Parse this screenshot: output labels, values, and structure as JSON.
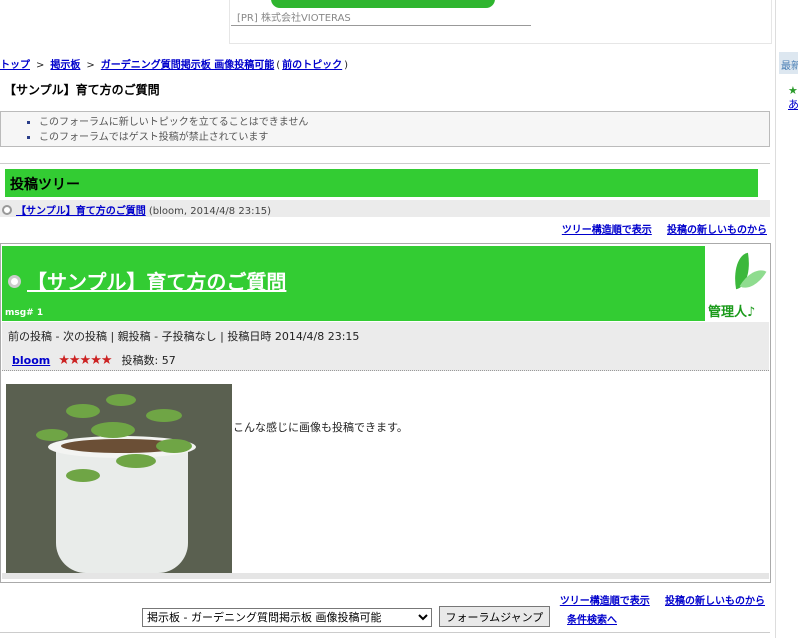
{
  "ad": {
    "text": "[PR] 株式会社VIOTERAS"
  },
  "right_panel": {
    "box_label": "最新",
    "star": "★",
    "link": "あ"
  },
  "breadcrumb": {
    "items": [
      "トップ",
      "掲示板",
      "ガーデニング質問掲示板 画像投稿可能"
    ],
    "separator": ">",
    "prev_topic": "前のトピック",
    "paren_open": "(",
    "paren_close": ")"
  },
  "page": {
    "title": "【サンプル】育て方のご質問"
  },
  "notices": [
    "このフォーラムに新しいトピックを立てることはできません",
    "このフォーラムではゲスト投稿が禁止されています"
  ],
  "tree": {
    "header": "投稿ツリー",
    "row_link": "【サンプル】育て方のご質問",
    "row_meta": "(bloom, 2014/4/8 23:15)",
    "link_tree_order": "ツリー構造順で表示",
    "link_newest": "投稿の新しいものから"
  },
  "post": {
    "title": "【サンプル】育て方のご質問",
    "msg_no": "msg# 1",
    "admin_badge": "管理人♪",
    "nav_line": "前の投稿 - 次の投稿 | 親投稿 - 子投稿なし | 投稿日時 2014/4/8 23:15",
    "author": "bloom",
    "stars": "★★★★★",
    "rating": 5,
    "post_count": "投稿数: 57",
    "body": "こんな感じに画像も投稿できます。"
  },
  "footer": {
    "link_tree_order": "ツリー構造順で表示",
    "link_newest": "投稿の新しいものから",
    "forum_select_value": "掲示板 - ガーデニング質問掲示板 画像投稿可能",
    "jump_button": "フォーラムジャンプ",
    "search_link": "条件検索へ"
  },
  "colors": {
    "accent_green": "#33cc33",
    "link_blue": "#0000cc",
    "star_red": "#cc2222"
  }
}
